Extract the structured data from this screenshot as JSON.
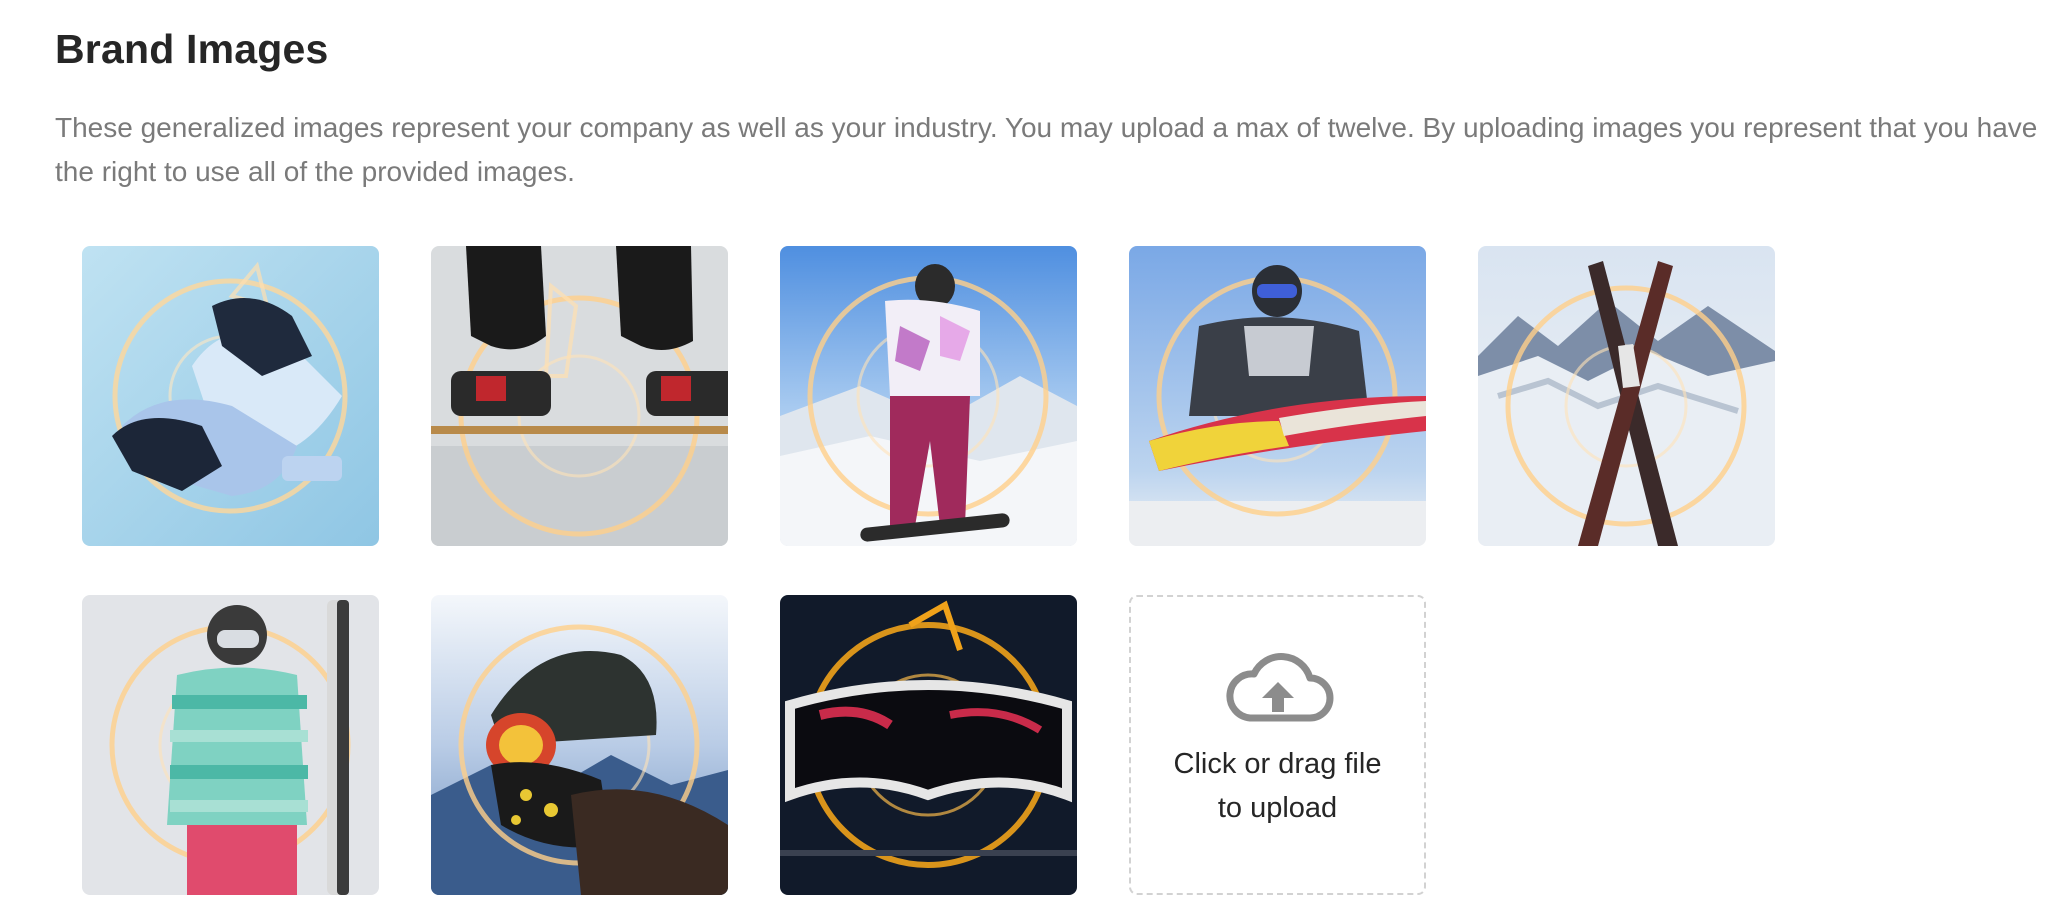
{
  "section": {
    "title": "Brand Images",
    "description": "These generalized images represent your company as well as your industry. You may upload a max of twelve. By uploading images you represent that you have the right to use all of the provided images."
  },
  "images": [
    {
      "subject": "ski gloves on snow"
    },
    {
      "subject": "snowboarder boots on board"
    },
    {
      "subject": "skier in pink pants on mountain"
    },
    {
      "subject": "snowboarder mid-air jump"
    },
    {
      "subject": "crossed skis in snow"
    },
    {
      "subject": "skier in striped jacket holding skis"
    },
    {
      "subject": "person with helmet and goggles"
    },
    {
      "subject": "ski goggles close-up"
    }
  ],
  "upload": {
    "icon": "cloud-upload-icon",
    "label": "Click or drag file to upload"
  },
  "colors": {
    "title": "#262626",
    "description": "#7a7a7a",
    "dashed_border": "#d2d2d2",
    "icon": "#8c8c8c",
    "glow_ring": "#ffb347"
  }
}
